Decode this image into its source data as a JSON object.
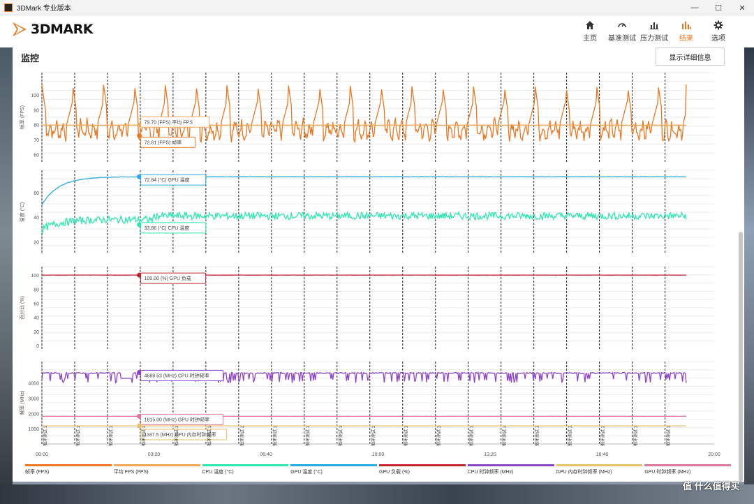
{
  "window": {
    "title": "3DMark 专业版本",
    "minimize": "—",
    "maximize": "☐",
    "close": "✕"
  },
  "brand": {
    "name": "3DMARK",
    "accent": "#e87722"
  },
  "nav": [
    {
      "label": "主页",
      "icon": "home-icon"
    },
    {
      "label": "基准测试",
      "icon": "speedometer-icon"
    },
    {
      "label": "压力测试",
      "icon": "bar-chart-icon"
    },
    {
      "label": "结果",
      "icon": "results-icon",
      "active": true
    },
    {
      "label": "选项",
      "icon": "gear-icon"
    }
  ],
  "panel": {
    "title": "监控",
    "detail_button": "显示详细信息"
  },
  "watermark": "值 什么值得买",
  "chart_data": {
    "type": "line",
    "x_ticks": [
      "00:00",
      "03:20",
      "06:40",
      "10:00",
      "13:20",
      "16:40",
      "20:00"
    ],
    "x_range_seconds": [
      0,
      1200
    ],
    "cursor_time": "02:54",
    "loop_marker_label": "循环测试 1",
    "loop_count": 20,
    "subplots": [
      {
        "ylabel": "帧率 (FPS)",
        "yticks": [
          60,
          70,
          80,
          90,
          100
        ],
        "ylim": [
          55,
          115
        ],
        "series": [
          {
            "name": "帧率 (FPS)",
            "color": "#e87722",
            "pattern": "sawtooth",
            "min": 70,
            "max": 107,
            "end": 107
          },
          {
            "name": "平均 FPS",
            "color": "#f2a65a",
            "flat": 79.7
          }
        ],
        "tooltips": [
          {
            "text": "79.70 (FPS) 平均 FPS",
            "color": "#f2a65a"
          },
          {
            "text": "72.61 (FPS) 帧率",
            "color": "#e87722"
          }
        ]
      },
      {
        "ylabel": "温度 (°C)",
        "yticks": [
          20,
          40,
          60
        ],
        "ylim": [
          10,
          78
        ],
        "series": [
          {
            "name": "GPU 温度 (°C)",
            "color": "#29abe2",
            "start": 50,
            "plateau": 72.8
          },
          {
            "name": "CPU 温度 (°C)",
            "color": "#2ee6b0",
            "start": 30,
            "plateau": 38
          }
        ],
        "tooltips": [
          {
            "text": "72.84 (°C) GPU 温度",
            "color": "#29abe2"
          },
          {
            "text": "33.86 (°C) CPU 温度",
            "color": "#2ee6b0"
          }
        ]
      },
      {
        "ylabel": "百分比 (%)",
        "yticks": [
          0,
          20,
          40,
          60,
          80,
          100
        ],
        "ylim": [
          -5,
          112
        ],
        "series": [
          {
            "name": "GPU 负载 (%)",
            "color": "#c0272d",
            "flat": 100
          }
        ],
        "tooltips": [
          {
            "text": "100.00 (%) GPU 负载",
            "color": "#c0272d"
          }
        ]
      },
      {
        "ylabel": "频率 (MHz)",
        "yticks": [
          1000,
          2000,
          3000,
          4000
        ],
        "ylim": [
          0,
          5400
        ],
        "series": [
          {
            "name": "CPU 时钟频率 (MHz)",
            "color": "#8e44c8",
            "base": 4688,
            "dip": 4300
          },
          {
            "name": "GPU 时钟频率 (MHz)",
            "color": "#e0789a",
            "flat": 1815
          },
          {
            "name": "GPU 内存时钟频率 (MHz)",
            "color": "#e8c06a",
            "flat": 1187.5
          }
        ],
        "tooltips": [
          {
            "text": "4688.53 (MHz) CPU 时钟频率",
            "color": "#8e44c8"
          },
          {
            "text": "1815.00 (MHz) GPU 时钟频率",
            "color": "#e0789a"
          },
          {
            "text": "1187.5 (MHz) GPU 内存时钟频率",
            "color": "#e8c06a"
          }
        ]
      }
    ],
    "legend": [
      {
        "name": "帧率 (FPS)",
        "color": "#e87722"
      },
      {
        "name": "平均 FPS (FPS)",
        "color": "#f2a65a"
      },
      {
        "name": "CPU 温度 (°C)",
        "color": "#2ee6b0"
      },
      {
        "name": "GPU 温度 (°C)",
        "color": "#29abe2"
      },
      {
        "name": "GPU 负载 (%)",
        "color": "#c0272d"
      },
      {
        "name": "CPU 时钟频率 (MHz)",
        "color": "#8e44c8"
      },
      {
        "name": "GPU 内存时钟频率 (MHz)",
        "color": "#e8c06a"
      },
      {
        "name": "GPU 时钟频率 (MHz)",
        "color": "#e0789a"
      }
    ]
  }
}
